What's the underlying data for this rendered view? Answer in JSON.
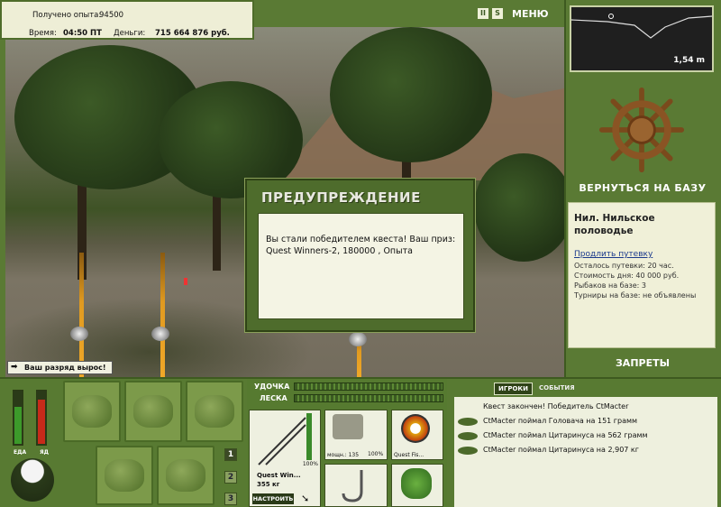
{
  "top": {
    "exp_label": "Получено опыта:",
    "exp_value": "94500",
    "time_label": "Время:",
    "time_value": "04:50 ПТ",
    "money_label": "Деньги:",
    "money_value": "715 664 876 руб."
  },
  "controls": {
    "pause_icon": "pause-icon",
    "sound_icon": "s-icon",
    "menu_label": "МЕНЮ"
  },
  "depth": {
    "value": "1,54 m"
  },
  "base": {
    "return_label": "ВЕРНУТЬСЯ НА БАЗУ",
    "location_name": "Нил. Нильское половодье",
    "extend_link": "Продлить путевку",
    "lines": [
      "Осталось путевки: 20 час.",
      "Стоимость дня: 40 000 руб.",
      "Рыбаков на базе: 3",
      "Турниры на базе: не объявлены"
    ],
    "bans_label": "ЗАПРЕТЫ"
  },
  "dialog": {
    "title": "ПРЕДУПРЕЖДЕНИЕ",
    "message": "Вы стали победителем квеста! Ваш приз: Quest Winners-2, 180000 , Опыта"
  },
  "rank_message": "Ваш разряд вырос!",
  "status": {
    "food_label": "ЕДА",
    "poison_label": "ЯД",
    "food_level": 0.7,
    "poison_level": 0.85
  },
  "inventory": {
    "pages": [
      "1",
      "2",
      "3"
    ],
    "selected_page": "1",
    "slots": [
      "backpack-icon",
      "sack-icon",
      "stick-icon",
      "fishing-net-icon",
      "vegetable-basket-icon",
      "wooden-bucket-icon"
    ]
  },
  "gear": {
    "rod_label": "УДОЧКА",
    "line_label": "ЛЕСКА",
    "rod_name": "Quest Win...",
    "rod_weight": "355 кг",
    "rod_percent": "100%",
    "reel_caption": "мощн.: 135",
    "reel_percent": "100%",
    "line_name": "Quest Fis...",
    "setup_label": "НАСТРОИТЬ"
  },
  "events": {
    "tabs": [
      "ИГРОКИ",
      "СОБЫТИЯ"
    ],
    "active_tab": "ИГРОКИ",
    "items": [
      "Квест закончен! Победитель CtMacter",
      "CtMacter поймал Головача на 151 грамм",
      "CtMacter поймал Цитаринуса на 562 грамм",
      "CtMacter поймал Цитаринуса на 2,907 кг"
    ]
  }
}
